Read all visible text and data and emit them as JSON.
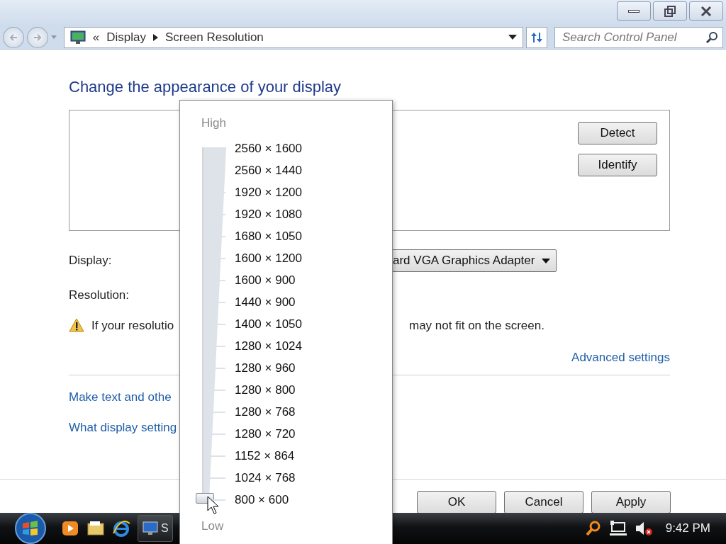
{
  "address_bar": {
    "overflow": "«",
    "crumbs": [
      "Display",
      "Screen Resolution"
    ]
  },
  "search": {
    "placeholder": "Search Control Panel"
  },
  "heading": "Change the appearance of your display",
  "preview_buttons": [
    "Detect",
    "Identify"
  ],
  "display": {
    "label": "Display:",
    "value": "ard VGA Graphics Adapter"
  },
  "resolution": {
    "label": "Resolution:"
  },
  "warning": {
    "left": "If your resolutio",
    "right": "may not fit on the screen."
  },
  "advanced_link": "Advanced settings",
  "links": [
    "Make text and othe",
    "What display setting"
  ],
  "buttons": [
    "OK",
    "Cancel",
    "Apply"
  ],
  "resolution_popup": {
    "high_label": "High",
    "low_label": "Low",
    "level": 0,
    "options": [
      "2560 × 1600",
      "2560 × 1440",
      "1920 × 1200",
      "1920 × 1080",
      "1680 × 1050",
      "1600 × 1200",
      "1600 × 900",
      "1440 × 900",
      "1400 × 1050",
      "1280 × 1024",
      "1280 × 960",
      "1280 × 800",
      "1280 × 768",
      "1280 × 720",
      "1152 × 864",
      "1024 × 768",
      "800 × 600"
    ]
  },
  "taskbar": {
    "task_label": "S",
    "clock": "9:42 PM"
  }
}
